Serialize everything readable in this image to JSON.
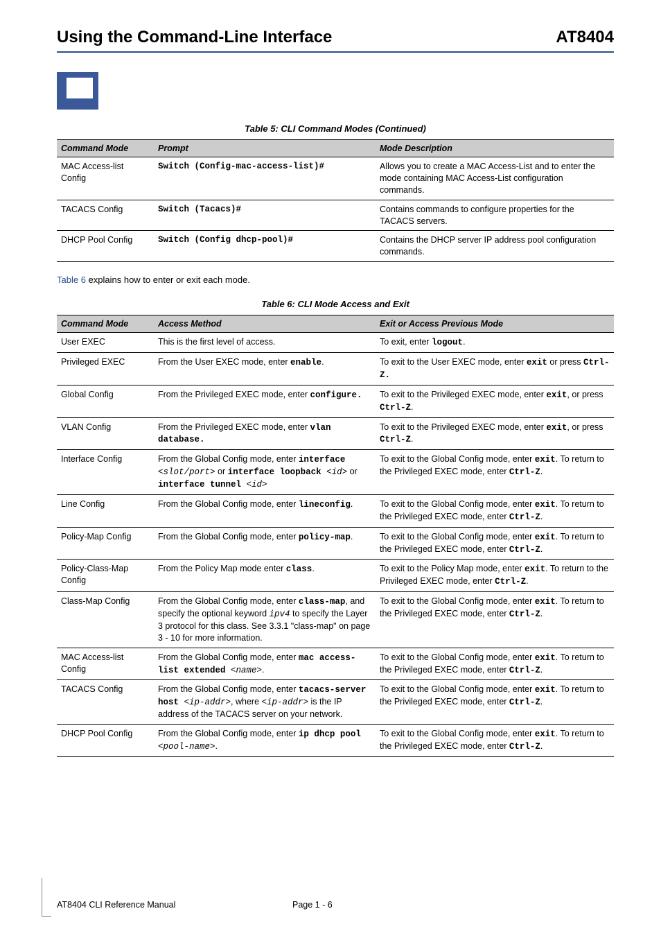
{
  "header": {
    "left": "Using the Command-Line Interface",
    "right": "AT8404"
  },
  "table5": {
    "caption": "Table 5:  CLI Command Modes (Continued)",
    "head": {
      "c1": "Command Mode",
      "c2": "Prompt",
      "c3": "Mode Description"
    },
    "rows": [
      {
        "mode": "MAC Access-list Config",
        "prompt": "Switch (Config-mac-access-list)#",
        "desc": "Allows you to create a MAC Access-List and to enter the mode containing MAC Access-List configuration commands."
      },
      {
        "mode": "TACACS Config",
        "prompt": "Switch (Tacacs)#",
        "desc": "Contains commands to configure properties for the TACACS servers."
      },
      {
        "mode": "DHCP Pool Config",
        "prompt": "Switch (Config dhcp-pool)#",
        "desc": "Contains the DHCP server IP address pool configuration commands."
      }
    ]
  },
  "intertext": {
    "link": "Table 6",
    "rest": " explains how to enter or exit each mode."
  },
  "table6": {
    "caption": "Table 6:  CLI Mode Access and Exit",
    "head": {
      "c1": "Command Mode",
      "c2": "Access Method",
      "c3": "Exit or Access Previous Mode"
    },
    "rows": [
      {
        "mode": "User EXEC",
        "access_pre": "This is the first level of access.",
        "exit_pre": "To exit, enter ",
        "exit_mono": "logout",
        "exit_post": "."
      },
      {
        "mode": "Privileged EXEC",
        "access_pre": "From the User EXEC mode, enter ",
        "access_mono": "enable",
        "access_post": ".",
        "exit_pre": "To exit to the User EXEC mode, enter ",
        "exit_mono": "exit",
        "exit_mid": " or press ",
        "exit_mono2": "Ctrl-Z.",
        "exit_post": ""
      },
      {
        "mode": "Global Config",
        "access_pre": "From the Privileged EXEC mode, enter ",
        "access_mono": "configure.",
        "exit_pre": "To exit to the Privileged EXEC mode, enter ",
        "exit_mono": "exit",
        "exit_mid": ", or press ",
        "exit_mono2": "Ctrl-Z",
        "exit_post": "."
      },
      {
        "mode": "VLAN Config",
        "access_pre": "From the Privileged EXEC mode, enter ",
        "access_mono": "vlan database.",
        "exit_pre": "To exit to the Privileged EXEC mode, enter ",
        "exit_mono": "exit",
        "exit_mid": ", or press  ",
        "exit_mono2": "Ctrl-Z",
        "exit_post": "."
      },
      {
        "mode": "Interface Config",
        "access_html": "From the Global Config mode, enter <span class='mono'>interface </span><span class='mono-it'>&lt;slot/port&gt;</span> or <span class='mono'>interface loopback </span><span class='mono-it'>&lt;id&gt;</span> or <span class='mono'>interface tunnel </span><span class='mono-it'>&lt;id&gt;</span>",
        "exit_html": "To exit to the Global Config mode, enter <span class='mono'>exit</span>. To return to the Privileged EXEC mode, enter <span class='mono'>Ctrl-Z</span>."
      },
      {
        "mode": "Line Config",
        "access_pre": "From the Global Config mode, enter ",
        "access_mono": "lineconfig",
        "access_post": ".",
        "exit_html": "To exit to the Global Config mode, enter <span class='mono'>exit</span>. To return to the Privileged EXEC mode, enter <span class='mono'>Ctrl-Z</span>."
      },
      {
        "mode": "Policy-Map Config",
        "access_pre": "From the Global Config mode, enter ",
        "access_mono": "policy-map",
        "access_post": ".",
        "exit_html": "To exit to the Global Config mode, enter <span class='mono'>exit</span>. To return to the Privileged EXEC mode, enter <span class='mono'>Ctrl-Z</span>."
      },
      {
        "mode": "Policy-Class-Map Config",
        "access_pre": "From the Policy Map mode enter ",
        "access_mono": "class",
        "access_post": ".",
        "exit_html": "To exit to the Policy Map mode, enter <span class='mono'>exit</span>. To return to the Privileged EXEC mode, enter <span class='mono'>Ctrl-Z</span>."
      },
      {
        "mode": "Class-Map Config",
        "access_html": "From the Global Config mode, enter <span class='mono'>class-map</span>, and specify the optional keyword <span class='mono-it'>ipv4</span> to specify the Layer 3 protocol for this class. See 3.3.1 \"class-map\" on page 3 - 10 for more information.",
        "exit_html": "To exit to the Global Config mode, enter <span class='mono'>exit</span>. To return to the Privileged EXEC mode, enter <span class='mono'>Ctrl-Z</span>."
      },
      {
        "mode": "MAC Access-list Config",
        "access_html": "From the Global Config mode, enter <span class='mono'>mac access-list extended </span><span class='mono-it'>&lt;name&gt;</span>.",
        "exit_html": "To exit to the Global Config mode, enter <span class='mono'>exit</span>. To return to the Privileged EXEC mode, enter <span class='mono'>Ctrl-Z</span>."
      },
      {
        "mode": "TACACS Config",
        "access_html": "From the Global Config mode, enter <span class='mono'>tacacs-server host </span><span class='mono-it'>&lt;ip-addr&gt;</span>, where <span class='mono-it'>&lt;ip-addr&gt;</span> is the IP address of the TACACS server on your network.",
        "exit_html": "To exit to the Global Config mode, enter <span class='mono'>exit</span>. To return to the Privileged EXEC mode, enter <span class='mono'>Ctrl-Z</span>."
      },
      {
        "mode": "DHCP Pool Config",
        "access_html": "From the Global Config mode, enter <span class='mono'>ip dhcp pool </span><span class='mono-it'>&lt;pool-name&gt;</span>.",
        "exit_html": "To exit to the Global Config mode, enter <span class='mono'>exit</span>. To return to the Privileged EXEC mode, enter <span class='mono'>Ctrl-Z</span>."
      }
    ]
  },
  "footer": {
    "left": "AT8404 CLI Reference Manual",
    "page": "Page 1 - 6"
  }
}
